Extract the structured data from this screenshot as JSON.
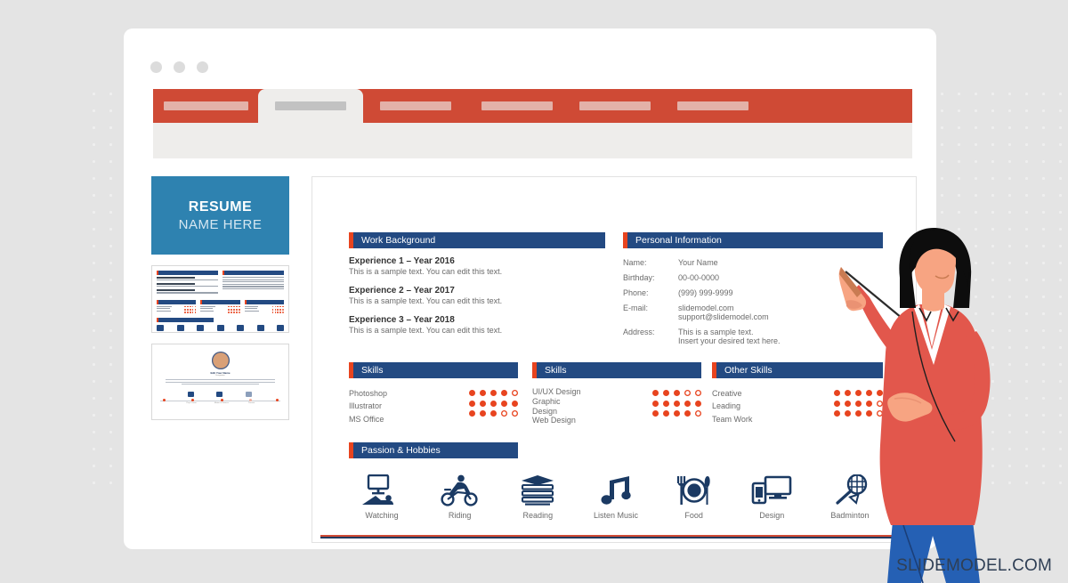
{
  "background": {
    "color": "#e4e4e4",
    "dot_color": "#efefef"
  },
  "colors": {
    "accent_red": "#cf4a35",
    "bar_navy": "#234a82",
    "bar_accent": "#e8441f",
    "hero_blue": "#2e82b0",
    "icon_navy": "#1b3a63",
    "jeans_blue": "#2560b4",
    "blouse_red": "#e2574c",
    "skin": "#f7a482"
  },
  "window": {
    "traffic_lights": [
      "window-dot-1",
      "window-dot-2",
      "window-dot-3"
    ],
    "tabs": [
      {
        "name": "tab-1",
        "active": false,
        "width": 118,
        "placeholder_width": 95
      },
      {
        "name": "tab-2",
        "active": true,
        "width": 118,
        "placeholder_width": 80
      },
      {
        "name": "tab-3",
        "active": false,
        "width": 118,
        "placeholder_width": 80
      },
      {
        "name": "tab-4",
        "active": false,
        "width": 118,
        "placeholder_width": 80
      },
      {
        "name": "tab-5",
        "active": false,
        "width": 118,
        "placeholder_width": 80
      },
      {
        "name": "tab-6",
        "active": false,
        "width": 118,
        "placeholder_width": 80
      }
    ]
  },
  "rail": {
    "hero": {
      "line1": "RESUME",
      "line2": "NAME HERE"
    },
    "thumbnails": [
      {
        "name": "thumbnail-resume-slide",
        "caption": ""
      },
      {
        "name": "thumbnail-timeline-slide",
        "caption": ""
      }
    ],
    "thumb_b": {
      "name": "Edit Your Name",
      "designation": "Designation",
      "milestones": [
        "Prep Course",
        "Master of Science",
        "Present"
      ]
    }
  },
  "slide": {
    "work_background": {
      "title": "Work Background",
      "experiences": [
        {
          "heading": "Experience 1 – Year 2016",
          "text": "This is a sample text. You can edit this text."
        },
        {
          "heading": "Experience 2 – Year 2017",
          "text": "This is a sample text. You can edit this text."
        },
        {
          "heading": "Experience 3 – Year 2018",
          "text": "This is a sample text. You can edit this text."
        }
      ]
    },
    "personal_information": {
      "title": "Personal Information",
      "fields": [
        {
          "label": "Name:",
          "value": "Your Name"
        },
        {
          "label": "Birthday:",
          "value": "00-00-0000"
        },
        {
          "label": "Phone:",
          "value": "(999) 999-9999"
        },
        {
          "label": "E-mail:",
          "value": "slidemodel.com\nsupport@slidemodel.com"
        },
        {
          "label": "Address:",
          "value": "This is a sample text.\nInsert your desired text here."
        }
      ]
    },
    "skills_left": {
      "title": "Skills",
      "items": [
        {
          "label": "Photoshop",
          "filled": 4,
          "total": 5
        },
        {
          "label": "Illustrator",
          "filled": 5,
          "total": 5
        },
        {
          "label": "MS Office",
          "filled": 3,
          "total": 5
        }
      ]
    },
    "skills_middle": {
      "title": "Skills",
      "items": [
        {
          "label": "UI/UX Design",
          "filled": 3,
          "total": 5
        },
        {
          "label": "Graphic",
          "filled": 5,
          "total": 5
        },
        {
          "label": "Design",
          "filled": 0,
          "total": 0
        },
        {
          "label": "Web Design",
          "filled": 4,
          "total": 5
        }
      ]
    },
    "other_skills": {
      "title": "Other Skills",
      "items": [
        {
          "label": "Creative",
          "filled": 5,
          "total": 5
        },
        {
          "label": "Leading",
          "filled": 4,
          "total": 5
        },
        {
          "label": "Team Work",
          "filled": 4,
          "total": 5
        }
      ]
    },
    "passion_hobbies": {
      "title": "Passion & Hobbies",
      "items": [
        {
          "label": "Watching",
          "icon": "tv-lounge-icon"
        },
        {
          "label": "Riding",
          "icon": "motorbike-icon"
        },
        {
          "label": "Reading",
          "icon": "book-stack-icon"
        },
        {
          "label": "Listen Music",
          "icon": "music-note-icon"
        },
        {
          "label": "Food",
          "icon": "plate-cutlery-icon"
        },
        {
          "label": "Design",
          "icon": "devices-icon"
        },
        {
          "label": "Badminton",
          "icon": "badminton-racket-icon"
        }
      ]
    }
  },
  "watermark": "SLIDEMODEL.COM"
}
